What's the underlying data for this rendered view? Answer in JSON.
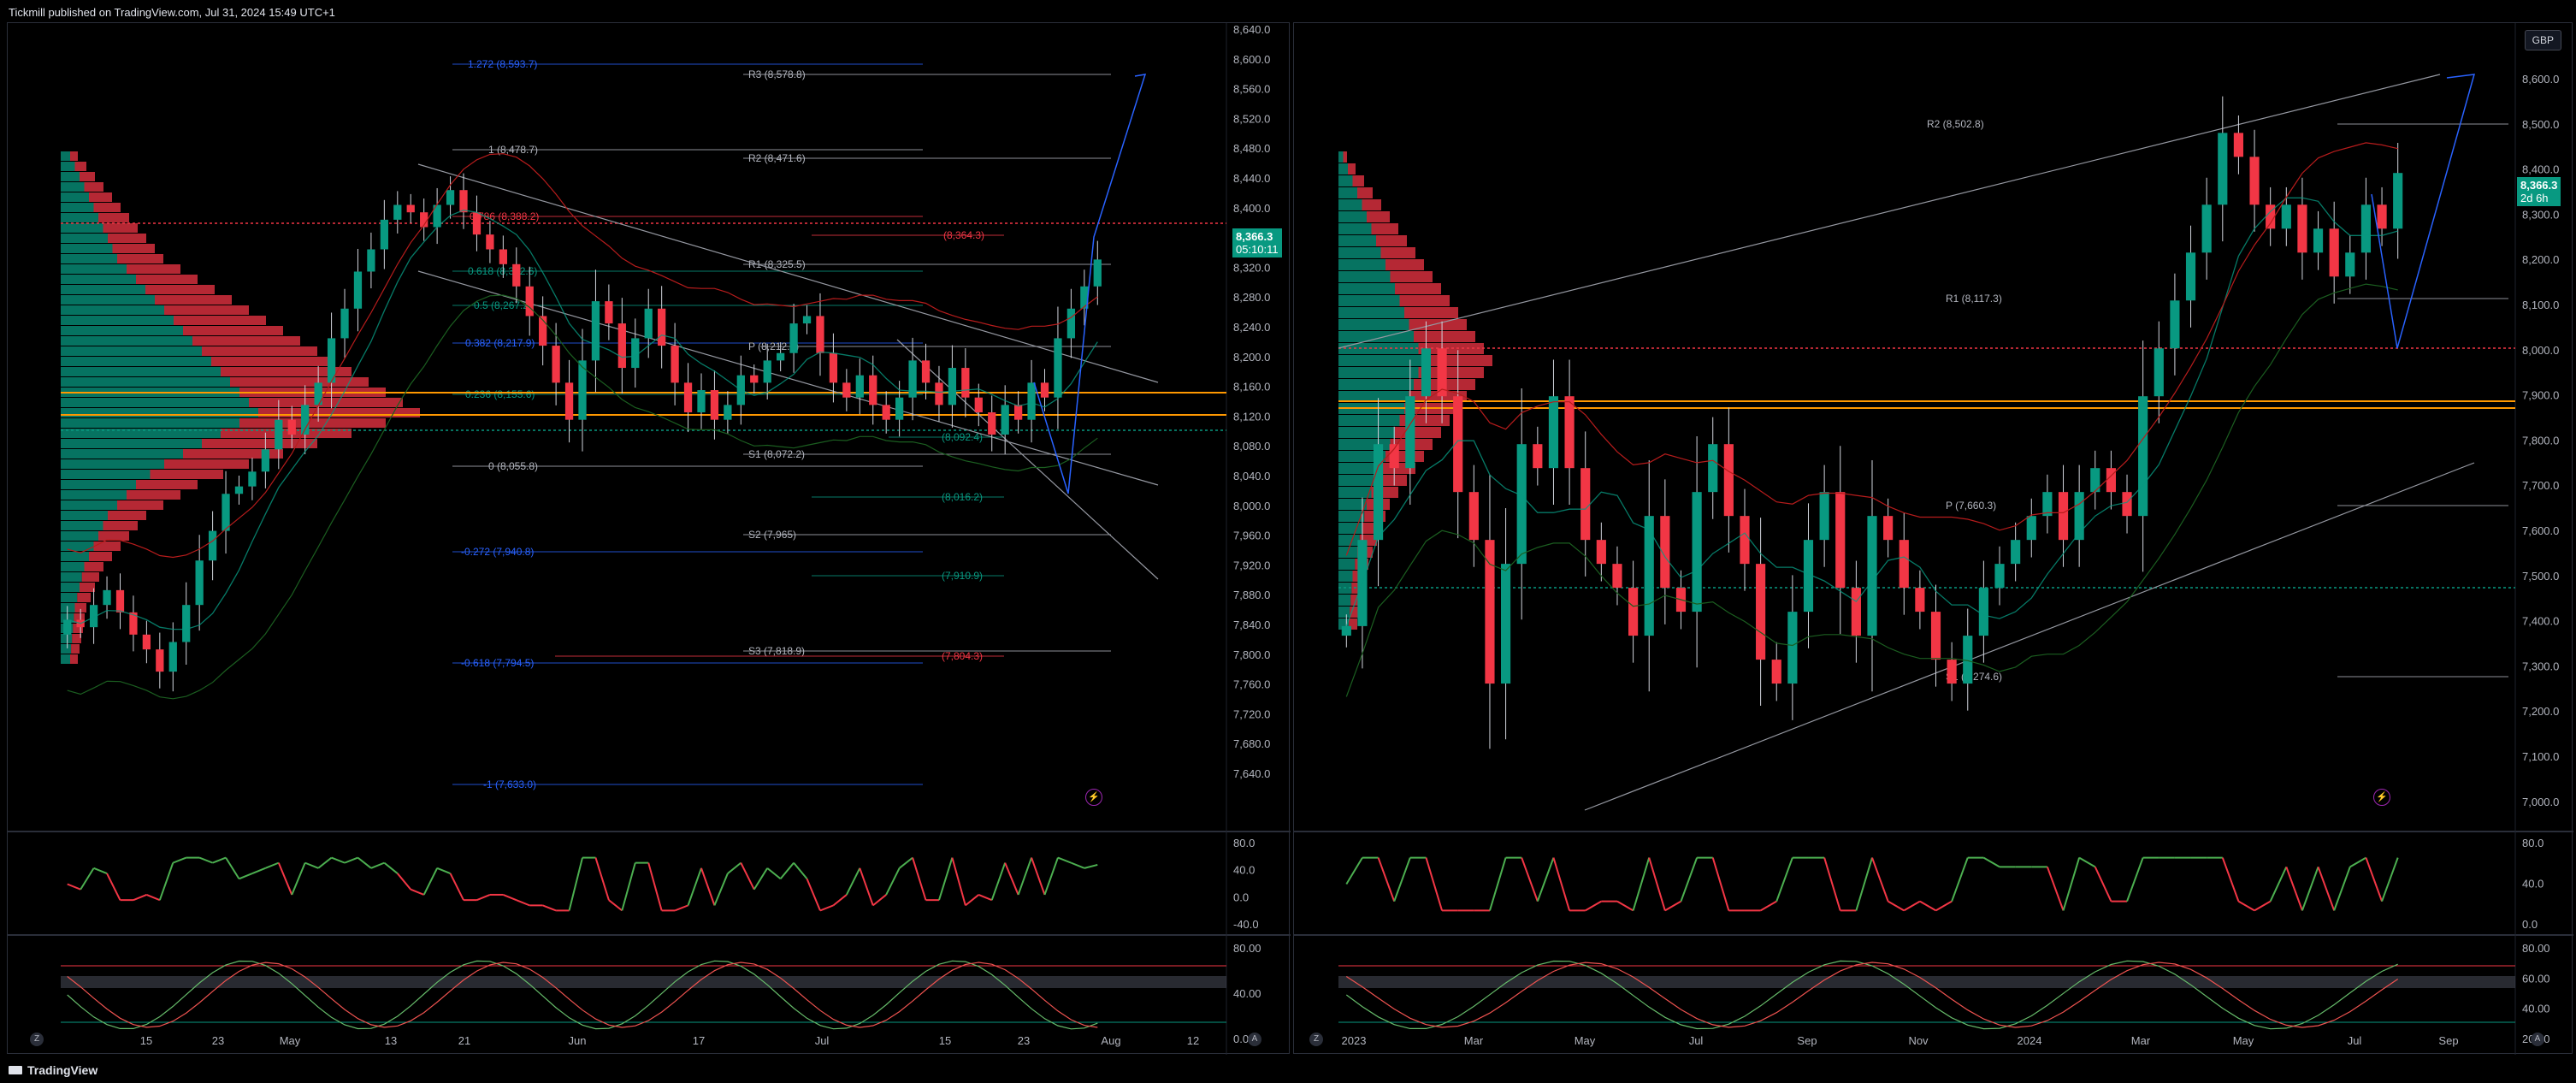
{
  "header": {
    "publisher_text": "Tickmill published on TradingView.com, Jul 31, 2024 15:49 UTC+1"
  },
  "footer": {
    "brand": "TradingView"
  },
  "colors": {
    "up": "#089981",
    "down": "#f23645",
    "orange": "#ff9800",
    "profile_up": "#089981",
    "profile_down": "#f23645"
  },
  "left_panel": {
    "price_axis": [
      "8,640.0",
      "8,600.0",
      "8,560.0",
      "8,520.0",
      "8,480.0",
      "8,440.0",
      "8,400.0",
      "8,360.0",
      "8,320.0",
      "8,280.0",
      "8,240.0",
      "8,200.0",
      "8,160.0",
      "8,120.0",
      "8,080.0",
      "8,040.0",
      "8,000.0",
      "7,960.0",
      "7,920.0",
      "7,880.0",
      "7,840.0",
      "7,800.0",
      "7,760.0",
      "7,720.0",
      "7,680.0",
      "7,640.0"
    ],
    "price_badge": {
      "price": "8,366.3",
      "countdown": "05:10:11"
    },
    "time_axis": [
      "15",
      "23",
      "May",
      "13",
      "21",
      "Jun",
      "17",
      "Jul",
      "15",
      "23",
      "Aug",
      "12"
    ],
    "rsi_axis": [
      "80.0",
      "40.0",
      "0.0",
      "-40.0"
    ],
    "stoch_axis": [
      "80.00",
      "40.00",
      "0.00"
    ],
    "levels": [
      {
        "label": "1.272 (8,593.7)",
        "color": "#2962ff"
      },
      {
        "label": "R3 (8,578.8)",
        "color": "#b2b5be"
      },
      {
        "label": "1 (8,478.7)",
        "color": "#b2b5be"
      },
      {
        "label": "R2 (8,471.6)",
        "color": "#b2b5be"
      },
      {
        "label": "0.786 (8,388.2)",
        "color": "#f23645"
      },
      {
        "label": "(8,364.3)",
        "color": "#f23645"
      },
      {
        "label": "R1 (8,325.5)",
        "color": "#b2b5be"
      },
      {
        "label": "0.618 (8,322.6)",
        "color": "#089981"
      },
      {
        "label": "0.5 (8,267.2)",
        "color": "#089981"
      },
      {
        "label": "0.382 (8,217.9)",
        "color": "#2962ff"
      },
      {
        "label": "P (8,212.5)",
        "color": "#b2b5be"
      },
      {
        "label": "0.236 (8,155.6)",
        "color": "#089981"
      },
      {
        "label": "(8,092.4)",
        "color": "#089981"
      },
      {
        "label": "S1 (8,072.2)",
        "color": "#b2b5be"
      },
      {
        "label": "0 (8,055.8)",
        "color": "#b2b5be"
      },
      {
        "label": "(8,016.2)",
        "color": "#089981"
      },
      {
        "label": "S2 (7,965)",
        "color": "#b2b5be"
      },
      {
        "label": "-0.272 (7,940.8)",
        "color": "#2962ff"
      },
      {
        "label": "(7,910.9)",
        "color": "#089981"
      },
      {
        "label": "S3 (7,818.9)",
        "color": "#b2b5be"
      },
      {
        "label": "(7,804.3)",
        "color": "#f23645"
      },
      {
        "label": "-0.618 (7,794.5)",
        "color": "#2962ff"
      },
      {
        "label": "-1 (7,633.0)",
        "color": "#2962ff"
      }
    ]
  },
  "right_panel": {
    "currency": "GBP",
    "price_axis": [
      "8,600.0",
      "8,500.0",
      "8,400.0",
      "8,300.0",
      "8,200.0",
      "8,100.0",
      "8,000.0",
      "7,900.0",
      "7,800.0",
      "7,700.0",
      "7,600.0",
      "7,500.0",
      "7,400.0",
      "7,300.0",
      "7,200.0",
      "7,100.0",
      "7,000.0"
    ],
    "price_badge": {
      "price": "8,366.3",
      "countdown": "2d 6h"
    },
    "time_axis": [
      "2023",
      "Mar",
      "May",
      "Jul",
      "Sep",
      "Nov",
      "2024",
      "Mar",
      "May",
      "Jul",
      "Sep"
    ],
    "rsi_axis": [
      "80.0",
      "40.0",
      "0.0"
    ],
    "stoch_axis": [
      "80.00",
      "60.00",
      "40.00",
      "20.00"
    ],
    "levels": [
      {
        "label": "R2 (8,502.8)",
        "color": "#b2b5be"
      },
      {
        "label": "R1 (8,117.3)",
        "color": "#b2b5be"
      },
      {
        "label": "P (7,660.3)",
        "color": "#b2b5be"
      },
      {
        "label": "S1 (7,274.6)",
        "color": "#b2b5be"
      }
    ]
  },
  "chart_data": [
    {
      "type": "candlestick",
      "title": "",
      "timeframe_labels": [
        "15",
        "23",
        "May",
        "13",
        "21",
        "Jun",
        "17",
        "Jul",
        "15",
        "23",
        "Aug",
        "12"
      ],
      "ylim": [
        7600,
        8660
      ],
      "last_price": 8366.3,
      "ohlc_close": [
        7880,
        7870,
        7900,
        7920,
        7890,
        7860,
        7840,
        7810,
        7850,
        7900,
        7960,
        8000,
        8050,
        8060,
        8080,
        8110,
        8150,
        8130,
        8170,
        8200,
        8260,
        8300,
        8350,
        8380,
        8420,
        8440,
        8430,
        8410,
        8440,
        8460,
        8430,
        8400,
        8380,
        8360,
        8330,
        8290,
        8250,
        8200,
        8150,
        8230,
        8310,
        8280,
        8220,
        8260,
        8300,
        8250,
        8200,
        8160,
        8190,
        8150,
        8170,
        8210,
        8200,
        8230,
        8240,
        8280,
        8290,
        8240,
        8200,
        8180,
        8210,
        8170,
        8150,
        8180,
        8230,
        8200,
        8170,
        8220,
        8180,
        8160,
        8130,
        8170,
        8150,
        8200,
        8180,
        8260,
        8300,
        8330,
        8366.3
      ],
      "pivot_levels": {
        "R3": 8578.8,
        "R2": 8471.6,
        "R1": 8325.5,
        "P": 8212.5,
        "S1": 8072.2,
        "S2": 7965,
        "S3": 7818.9
      },
      "fib_levels": {
        "1.272": 8593.7,
        "1": 8478.7,
        "0.786": 8388.2,
        "0.618": 8322.6,
        "0.5": 8267.2,
        "0.382": 8217.9,
        "0.236": 8155.6,
        "0": 8055.8,
        "-0.272": 7940.8,
        "-0.618": 7794.5,
        "-1": 7633.0
      }
    },
    {
      "type": "candlestick",
      "title": "",
      "timeframe_labels": [
        "2023",
        "Mar",
        "May",
        "Jul",
        "Sep",
        "Nov",
        "2024",
        "Mar",
        "May",
        "Jul",
        "Sep"
      ],
      "ylim": [
        7000,
        8640
      ],
      "last_price": 8366.3,
      "ohlc_close": [
        7420,
        7600,
        7800,
        7750,
        7900,
        8000,
        7900,
        7700,
        7600,
        7300,
        7550,
        7800,
        7750,
        7900,
        7750,
        7600,
        7550,
        7500,
        7400,
        7650,
        7500,
        7450,
        7700,
        7800,
        7650,
        7550,
        7350,
        7300,
        7450,
        7600,
        7700,
        7500,
        7400,
        7650,
        7600,
        7500,
        7450,
        7350,
        7300,
        7400,
        7500,
        7550,
        7600,
        7650,
        7700,
        7600,
        7700,
        7750,
        7700,
        7650,
        7900,
        8000,
        8100,
        8200,
        8300,
        8450,
        8400,
        8300,
        8250,
        8300,
        8200,
        8250,
        8150,
        8200,
        8300,
        8250,
        8366.3
      ],
      "pivot_levels": {
        "R2": 8502.8,
        "R1": 8117.3,
        "P": 7660.3,
        "S1": 7274.6
      }
    }
  ]
}
